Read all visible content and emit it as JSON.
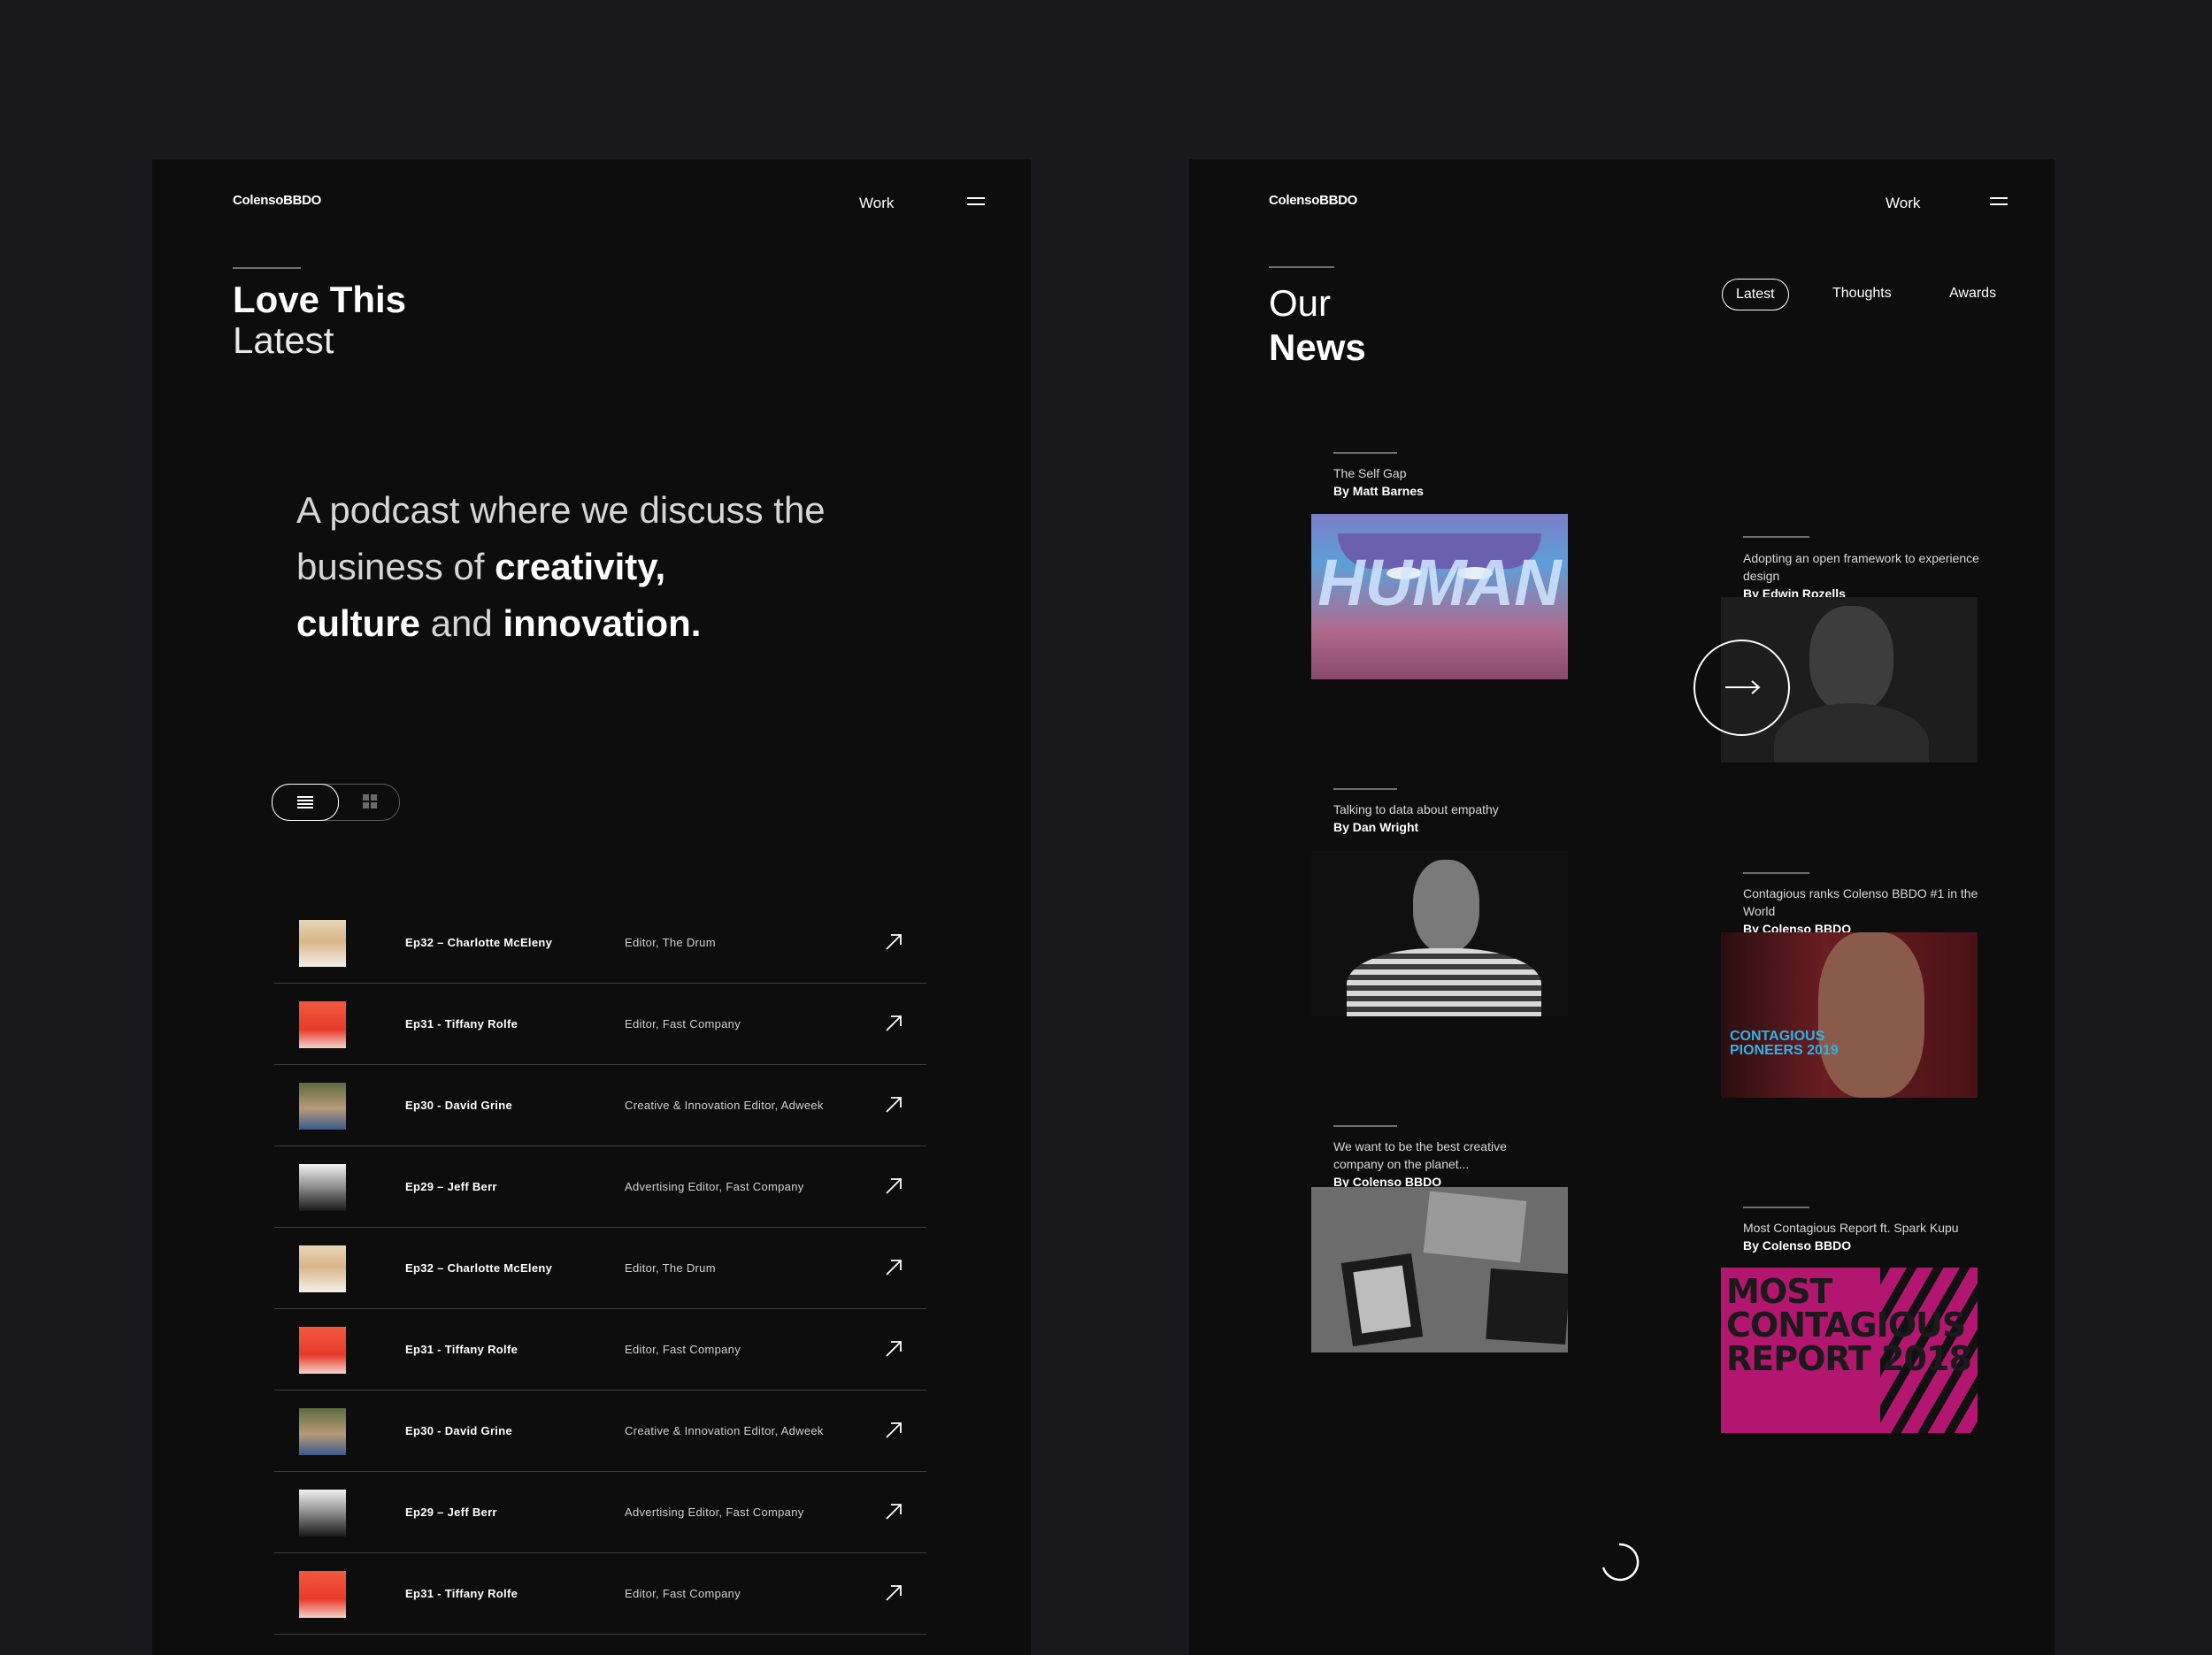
{
  "left": {
    "logo": "ColensoBBDO",
    "nav_work": "Work",
    "heading_line1": "Love This",
    "heading_line2": "Latest",
    "lead": {
      "part1": "A podcast where we discuss the business of ",
      "bold1": "creativity,",
      "bold2": "culture",
      "part2": " and ",
      "bold3": "innovation."
    },
    "view_toggle": {
      "active": "list",
      "icons": [
        "list-icon",
        "grid-icon"
      ]
    },
    "episodes": [
      {
        "title": "Ep32 – Charlotte McEleny",
        "role": "Editor, The Drum"
      },
      {
        "title": "Ep31 - Tiffany Rolfe",
        "role": "Editor, Fast Company"
      },
      {
        "title": "Ep30 -  David Grine",
        "role": "Creative & Innovation Editor, Adweek"
      },
      {
        "title": "Ep29 – Jeff Berr",
        "role": "Advertising Editor, Fast Company"
      },
      {
        "title": "Ep32 – Charlotte McEleny",
        "role": "Editor, The Drum"
      },
      {
        "title": "Ep31 - Tiffany Rolfe",
        "role": "Editor, Fast Company"
      },
      {
        "title": "Ep30 -  David Grine",
        "role": "Creative & Innovation Editor, Adweek"
      },
      {
        "title": "Ep29 – Jeff Berr",
        "role": "Advertising Editor, Fast Company"
      },
      {
        "title": "Ep31 - Tiffany Rolfe",
        "role": "Editor, Fast Company"
      }
    ]
  },
  "right": {
    "logo": "ColensoBBDO",
    "nav_work": "Work",
    "heading_line1": "Our",
    "heading_line2": "News",
    "filters": {
      "latest": "Latest",
      "thoughts": "Thoughts",
      "awards": "Awards"
    },
    "cards": [
      {
        "title": "The Self Gap",
        "by": "By Matt Barnes",
        "thumb_text": "HUMAN"
      },
      {
        "title": "Adopting an open framework to experience design",
        "by": "By Edwin Rozells"
      },
      {
        "title": "Talking to data about empathy",
        "by": "By Dan Wright"
      },
      {
        "title": "Contagious ranks Colenso BBDO #1 in the World",
        "by": "By Colenso BBDO",
        "thumb_text": "CONTAGIOUS PIONEERS 2019"
      },
      {
        "title": "We want to be the best creative company on the planet...",
        "by": "By Colenso BBDO"
      },
      {
        "title": "Most Contagious Report ft. Spark Kupu",
        "by": "By Colenso BBDO",
        "thumb_text": "MOST CONTAGIOUS REPORT 2018"
      }
    ]
  },
  "colors": {
    "background": "#19181a",
    "panel": "#0d0d0e",
    "magenta": "#b3166f"
  }
}
